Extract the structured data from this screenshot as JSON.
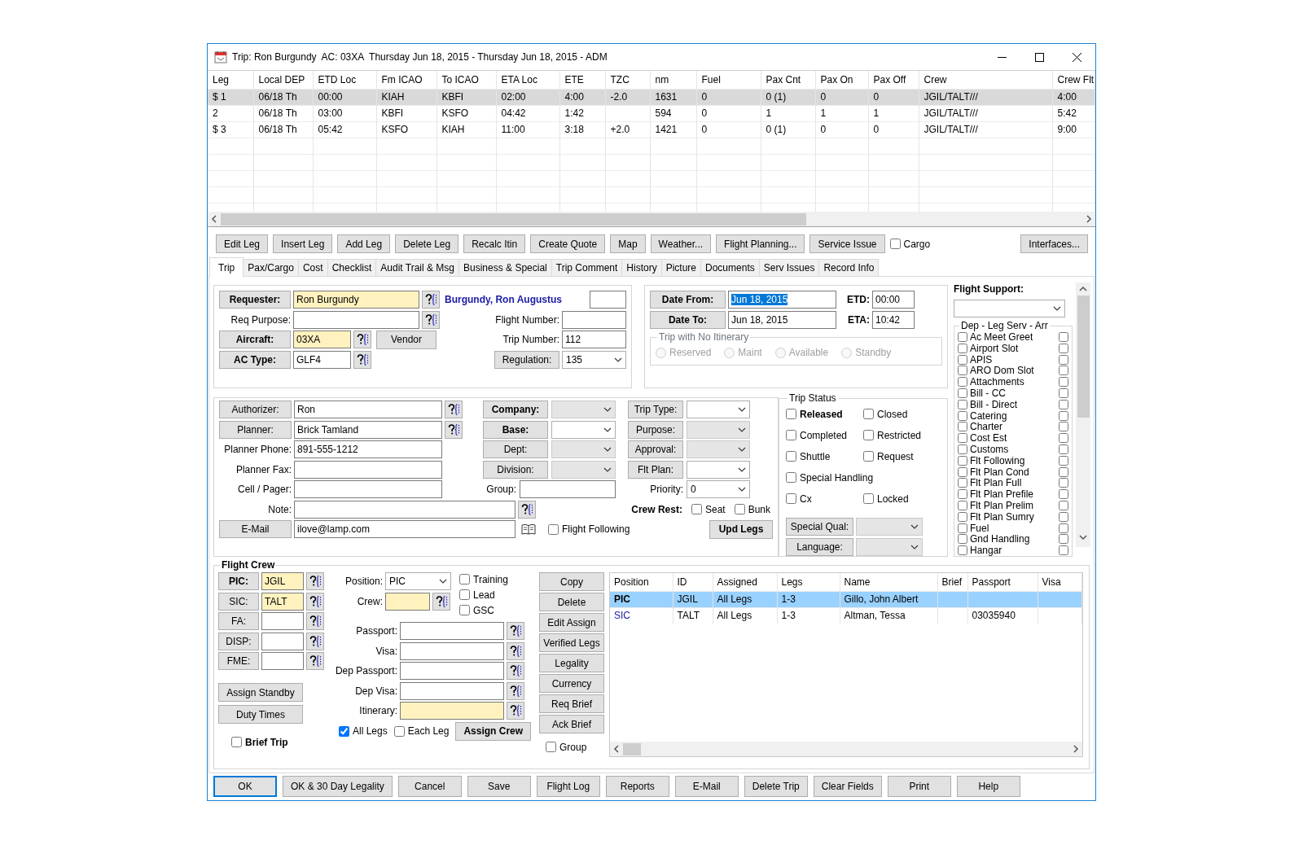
{
  "window": {
    "title": "Trip: Ron Burgundy  AC: 03XA  Thursday Jun 18, 2015 - Thursday Jun 18, 2015 - ADM"
  },
  "legs": {
    "columns": [
      "Leg",
      "Local DEP",
      "ETD Loc",
      "Fm ICAO",
      "To ICAO",
      "ETA Loc",
      "ETE",
      "TZC",
      "nm",
      "Fuel",
      "Pax Cnt",
      "Pax On",
      "Pax Off",
      "Crew",
      "Crew Flt"
    ],
    "rows": [
      {
        "selected": true,
        "cells": [
          "$ 1",
          "06/18 Th",
          "00:00",
          "KIAH",
          "KBFI",
          "02:00",
          "4:00",
          "-2.0",
          "1631",
          "0",
          "0 (1)",
          "0",
          "0",
          "JGIL/TALT///",
          "4:00"
        ]
      },
      {
        "selected": false,
        "cells": [
          "2",
          "06/18 Th",
          "03:00",
          "KBFI",
          "KSFO",
          "04:42",
          "1:42",
          null,
          "594",
          "0",
          "1",
          "1",
          "1",
          "JGIL/TALT///",
          "5:42"
        ]
      },
      {
        "selected": false,
        "cells": [
          "$ 3",
          "06/18 Th",
          "05:42",
          "KSFO",
          "KIAH",
          "11:00",
          "3:18",
          "+2.0",
          "1421",
          "0",
          "0 (1)",
          "0",
          "0",
          "JGIL/TALT///",
          "9:00"
        ]
      }
    ]
  },
  "toolbar": {
    "buttons": [
      "Edit Leg",
      "Insert Leg",
      "Add Leg",
      "Delete Leg",
      "Recalc Itin",
      "Create Quote",
      "Map",
      "Weather...",
      "Flight Planning...",
      "Service Issue"
    ],
    "cargo": {
      "label": "Cargo",
      "checked": false
    },
    "interfaces": "Interfaces..."
  },
  "tabs": [
    {
      "label": "Trip",
      "selected": true
    },
    {
      "label": "Pax/Cargo",
      "selected": false
    },
    {
      "label": "Cost",
      "selected": false
    },
    {
      "label": "Checklist",
      "selected": false
    },
    {
      "label": "Audit Trail & Msg",
      "selected": false
    },
    {
      "label": "Business & Special",
      "selected": false
    },
    {
      "label": "Trip Comment",
      "selected": false
    },
    {
      "label": "History",
      "selected": false
    },
    {
      "label": "Picture",
      "selected": false
    },
    {
      "label": "Documents",
      "selected": false
    },
    {
      "label": "Serv Issues",
      "selected": false
    },
    {
      "label": "Record Info",
      "selected": false
    }
  ],
  "trip": {
    "requester": {
      "label": "Requester:",
      "value": "Ron Burgundy",
      "highlighted": true,
      "required": true
    },
    "requester_name": "Burgundy, Ron Augustus",
    "req_purpose": {
      "label": "Req Purpose:",
      "highlighted": false
    },
    "aircraft": {
      "label": "Aircraft:",
      "value": "03XA",
      "highlighted": true,
      "required": true
    },
    "ac_type": {
      "label": "AC Type:",
      "value": "GLF4",
      "highlighted": false,
      "required": true
    },
    "vendor": "Vendor",
    "flight_number": {
      "label": "Flight Number:"
    },
    "trip_number": {
      "label": "Trip Number:",
      "value": "112"
    },
    "regulation": {
      "label": "Regulation:",
      "value": "135",
      "required": false,
      "disabled": false
    },
    "date_from": {
      "label": "Date From:",
      "value": "Jun 18, 2015",
      "text_selected": true,
      "required": true
    },
    "date_to": {
      "label": "Date To:",
      "value": "Jun 18, 2015",
      "text_selected": false,
      "required": true
    },
    "etd": {
      "label": "ETD:",
      "value": "00:00"
    },
    "eta": {
      "label": "ETA:",
      "value": "10:42"
    },
    "no_itinerary": {
      "title": "Trip with No Itinerary",
      "disabled": true,
      "options": [
        {
          "label": "Reserved",
          "selected": false
        },
        {
          "label": "Maint",
          "selected": false
        },
        {
          "label": "Available",
          "selected": false
        },
        {
          "label": "Standby",
          "selected": false
        }
      ]
    },
    "authorizer": {
      "label": "Authorizer:",
      "value": "Ron",
      "required": false
    },
    "planner": {
      "label": "Planner:",
      "value": "Brick Tamland",
      "required": false
    },
    "planner_phone": {
      "label": "Planner Phone:",
      "value": "891-555-1212"
    },
    "planner_fax": {
      "label": "Planner Fax:"
    },
    "cell_pager": {
      "label": "Cell / Pager:"
    },
    "note": {
      "label": "Note:"
    },
    "email": {
      "label": "E-Mail",
      "value": "ilove@lamp.com",
      "required": false
    },
    "company": {
      "label": "Company:",
      "required": true,
      "disabled": true
    },
    "base": {
      "label": "Base:",
      "required": true,
      "disabled": false
    },
    "dept": {
      "label": "Dept:",
      "required": false,
      "disabled": true
    },
    "division": {
      "label": "Division:",
      "required": false,
      "disabled": true
    },
    "group": {
      "label": "Group:"
    },
    "trip_type": {
      "label": "Trip Type:",
      "required": false,
      "disabled": false
    },
    "purpose": {
      "label": "Purpose:",
      "required": false,
      "disabled": true
    },
    "approval": {
      "label": "Approval:",
      "required": false,
      "disabled": true
    },
    "flt_plan": {
      "label": "Flt Plan:",
      "required": false,
      "disabled": false
    },
    "priority": {
      "label": "Priority:",
      "value": "0",
      "disabled": false
    },
    "crew_rest": {
      "label": "Crew Rest:",
      "options": [
        {
          "label": "Seat",
          "checked": false
        },
        {
          "label": "Bunk",
          "checked": false
        }
      ]
    },
    "flight_following": {
      "label": "Flight Following",
      "checked": false
    },
    "upd_legs": "Upd Legs",
    "trip_status": {
      "title": "Trip Status",
      "rows": [
        [
          {
            "label": "Released",
            "checked": false
          },
          {
            "label": "Closed",
            "checked": false
          }
        ],
        [
          {
            "label": "Completed",
            "checked": false
          },
          {
            "label": "Restricted",
            "checked": false
          }
        ],
        [
          {
            "label": "Shuttle",
            "checked": false
          },
          {
            "label": "Request",
            "checked": false
          }
        ],
        [
          {
            "label": "Special Handling",
            "checked": false
          }
        ],
        [
          {
            "label": "Cx",
            "checked": false
          },
          {
            "label": "Locked",
            "checked": false
          }
        ]
      ]
    },
    "special_qual": {
      "label": "Special Qual:",
      "required": false,
      "disabled": true
    },
    "language": {
      "label": "Language:",
      "required": false,
      "disabled": true
    }
  },
  "flight_support": {
    "title": "Flight Support:",
    "group_title": "Dep - Leg Serv - Arr",
    "items": [
      {
        "label": "Ac Meet Greet",
        "dep": false,
        "arr": false
      },
      {
        "label": "Airport Slot",
        "dep": false,
        "arr": false
      },
      {
        "label": "APIS",
        "dep": false,
        "arr": false
      },
      {
        "label": "ARO Dom Slot",
        "dep": false,
        "arr": false
      },
      {
        "label": "Attachments",
        "dep": false,
        "arr": false
      },
      {
        "label": "Bill - CC",
        "dep": false,
        "arr": false
      },
      {
        "label": "Bill - Direct",
        "dep": false,
        "arr": false
      },
      {
        "label": "Catering",
        "dep": false,
        "arr": false
      },
      {
        "label": "Charter",
        "dep": false,
        "arr": false
      },
      {
        "label": "Cost Est",
        "dep": false,
        "arr": false
      },
      {
        "label": "Customs",
        "dep": false,
        "arr": false
      },
      {
        "label": "Flt Following",
        "dep": false,
        "arr": false
      },
      {
        "label": "Flt Plan Cond",
        "dep": false,
        "arr": false
      },
      {
        "label": "Flt Plan Full",
        "dep": false,
        "arr": false
      },
      {
        "label": "Flt Plan Prefile",
        "dep": false,
        "arr": false
      },
      {
        "label": "Flt Plan Prelim",
        "dep": false,
        "arr": false
      },
      {
        "label": "Flt Plan Sumry",
        "dep": false,
        "arr": false
      },
      {
        "label": "Fuel",
        "dep": false,
        "arr": false
      },
      {
        "label": "Gnd Handling",
        "dep": false,
        "arr": false
      },
      {
        "label": "Hangar",
        "dep": false,
        "arr": false
      }
    ]
  },
  "flight_crew": {
    "title": "Flight Crew",
    "positions": [
      {
        "label": "PIC:",
        "value": "JGIL",
        "highlighted": true,
        "required": true
      },
      {
        "label": "SIC:",
        "value": "TALT",
        "highlighted": true,
        "required": false
      },
      {
        "label": "FA:",
        "highlighted": false,
        "required": false
      },
      {
        "label": "DISP:",
        "highlighted": false,
        "required": false
      },
      {
        "label": "FME:",
        "highlighted": false,
        "required": false
      }
    ],
    "assign_standby": "Assign Standby",
    "duty_times": "Duty Times",
    "brief_trip": {
      "label": "Brief Trip",
      "checked": false
    },
    "position": {
      "label": "Position:",
      "value": "PIC",
      "disabled": false
    },
    "crew": {
      "label": "Crew:",
      "highlighted": true
    },
    "options": [
      {
        "label": "Training",
        "checked": false
      },
      {
        "label": "Lead",
        "checked": false
      },
      {
        "label": "GSC",
        "checked": false
      }
    ],
    "documents": [
      {
        "label": "Passport:",
        "highlighted": false
      },
      {
        "label": "Visa:",
        "highlighted": false
      },
      {
        "label": "Dep Passport:",
        "highlighted": false
      },
      {
        "label": "Dep Visa:",
        "highlighted": false
      },
      {
        "label": "Itinerary:",
        "highlighted": true
      }
    ],
    "all_legs": {
      "label": "All Legs",
      "checked": true
    },
    "each_leg": {
      "label": "Each Leg",
      "checked": false
    },
    "assign_crew": "Assign Crew",
    "buttons": [
      "Copy",
      "Delete",
      "Edit Assign",
      "Verified Legs",
      "Legality",
      "Currency",
      "Req Brief",
      "Ack Brief"
    ],
    "group": {
      "label": "Group",
      "checked": false
    },
    "table": {
      "columns": [
        "Position",
        "ID",
        "Assigned",
        "Legs",
        "Name",
        "Brief",
        "Passport",
        "Visa"
      ],
      "rows": [
        {
          "selected": true,
          "cells": [
            "PIC",
            "JGIL",
            "All Legs",
            "1-3",
            "Gillo, John Albert",
            null,
            null,
            null
          ]
        },
        {
          "selected": false,
          "cells": [
            "SIC",
            "TALT",
            "All Legs",
            "1-3",
            "Altman, Tessa",
            null,
            "03035940",
            null
          ]
        }
      ]
    }
  },
  "footer_buttons": [
    {
      "label": "OK",
      "default": true
    },
    {
      "label": "OK & 30 Day Legality",
      "default": false
    },
    {
      "label": "Cancel",
      "default": false
    },
    {
      "label": "Save",
      "default": false
    },
    {
      "label": "Flight Log",
      "default": false
    },
    {
      "label": "Reports",
      "default": false
    },
    {
      "label": "E-Mail",
      "default": false
    },
    {
      "label": "Delete Trip",
      "default": false
    },
    {
      "label": "Clear Fields",
      "default": false
    },
    {
      "label": "Print",
      "default": false
    },
    {
      "label": "Help",
      "default": false
    }
  ]
}
